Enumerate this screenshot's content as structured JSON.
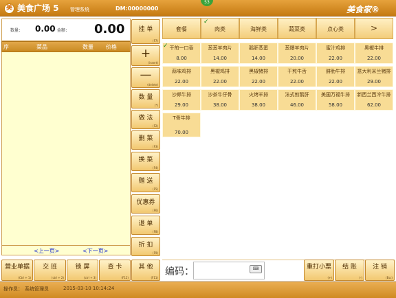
{
  "titlebar": {
    "logo": "美",
    "title": "美食广场 5",
    "subtitle": "管理系统",
    "dm": "DM:00000000",
    "brand": "美食家®",
    "badge": "53"
  },
  "order": {
    "qty_label": "数量：",
    "qty_value": "0.00",
    "amount_label": "金额：",
    "amount_value": "0.00"
  },
  "order_columns": [
    "序",
    "菜品",
    "数量",
    "价格"
  ],
  "pager": {
    "prev": "<上一页>",
    "next": "<下一页>"
  },
  "function_buttons": [
    {
      "label": "挂 单",
      "key": "(F7)"
    },
    {
      "label": "+",
      "key": "(insert)"
    },
    {
      "label": "—",
      "key": "(delete)"
    },
    {
      "label": "数 量",
      "key": "(*)"
    },
    {
      "label": "做 法",
      "key": "(F2)"
    },
    {
      "label": "删 菜",
      "key": "(F3)"
    },
    {
      "label": "换 菜",
      "key": "(F4)"
    },
    {
      "label": "赠 送",
      "key": "(F5)"
    },
    {
      "label": "优惠券",
      "key": "(F6)"
    },
    {
      "label": "退 单",
      "key": "(F8)"
    },
    {
      "label": "折 扣",
      "key": "(F9)"
    }
  ],
  "categories": [
    {
      "label": "套餐",
      "checked": false
    },
    {
      "label": "肉类",
      "checked": true
    },
    {
      "label": "海鲜类",
      "checked": false
    },
    {
      "label": "蔬菜类",
      "checked": false
    },
    {
      "label": "点心类",
      "checked": false
    },
    {
      "label": ">",
      "checked": false
    }
  ],
  "dishes": [
    {
      "name": "干煎一口香",
      "price": "8.00",
      "checked": true
    },
    {
      "name": "葱葱羊肉片",
      "price": "14.00",
      "checked": false
    },
    {
      "name": "鹅肝蒸蛋",
      "price": "14.00",
      "checked": false
    },
    {
      "name": "葱爆羊肉片",
      "price": "20.00",
      "checked": false
    },
    {
      "name": "蜜汁鸡排",
      "price": "22.00",
      "checked": false
    },
    {
      "name": "黑椒牛排",
      "price": "22.00",
      "checked": false
    },
    {
      "name": "蒜味鸡排",
      "price": "22.00",
      "checked": false
    },
    {
      "name": "黑椒鸡排",
      "price": "22.00",
      "checked": false
    },
    {
      "name": "黑椒猪排",
      "price": "22.00",
      "checked": false
    },
    {
      "name": "干煎牛舌",
      "price": "22.00",
      "checked": false
    },
    {
      "name": "腓肋牛排",
      "price": "22.00",
      "checked": false
    },
    {
      "name": "意大利米兰猪排",
      "price": "29.00",
      "checked": false
    },
    {
      "name": "沙郎牛排",
      "price": "29.00",
      "checked": false
    },
    {
      "name": "沙茶牛仔骨",
      "price": "38.00",
      "checked": false
    },
    {
      "name": "火烤羊排",
      "price": "38.00",
      "checked": false
    },
    {
      "name": "法式煎鹅肝",
      "price": "46.00",
      "checked": false
    },
    {
      "name": "美国万福牛排",
      "price": "58.00",
      "checked": false
    },
    {
      "name": "新西兰西冷牛排",
      "price": "62.00",
      "checked": false
    },
    {
      "name": "T骨牛排",
      "price": "70.00",
      "checked": false
    }
  ],
  "bottom_buttons": [
    {
      "label": "营业单据",
      "key": "(Ctrl + 1)"
    },
    {
      "label": "交 班",
      "key": "(ctrl + 2)"
    },
    {
      "label": "锁 屏",
      "key": "(ctrl + 3)"
    },
    {
      "label": "查 卡",
      "key": "(F12)"
    },
    {
      "label": "其 他",
      "key": "(F11)"
    }
  ],
  "code": {
    "label": "编码：",
    "value": "",
    "keyboard": "⌨"
  },
  "right_buttons": [
    {
      "label": "重打小票",
      "key": "(+)"
    },
    {
      "label": "结 账",
      "key": "(-)"
    },
    {
      "label": "注 销",
      "key": "(Esc)"
    }
  ],
  "status": {
    "operator_label": "操作员：",
    "operator": "系统管理员",
    "datetime": "2015-03-10 10:14:24"
  }
}
